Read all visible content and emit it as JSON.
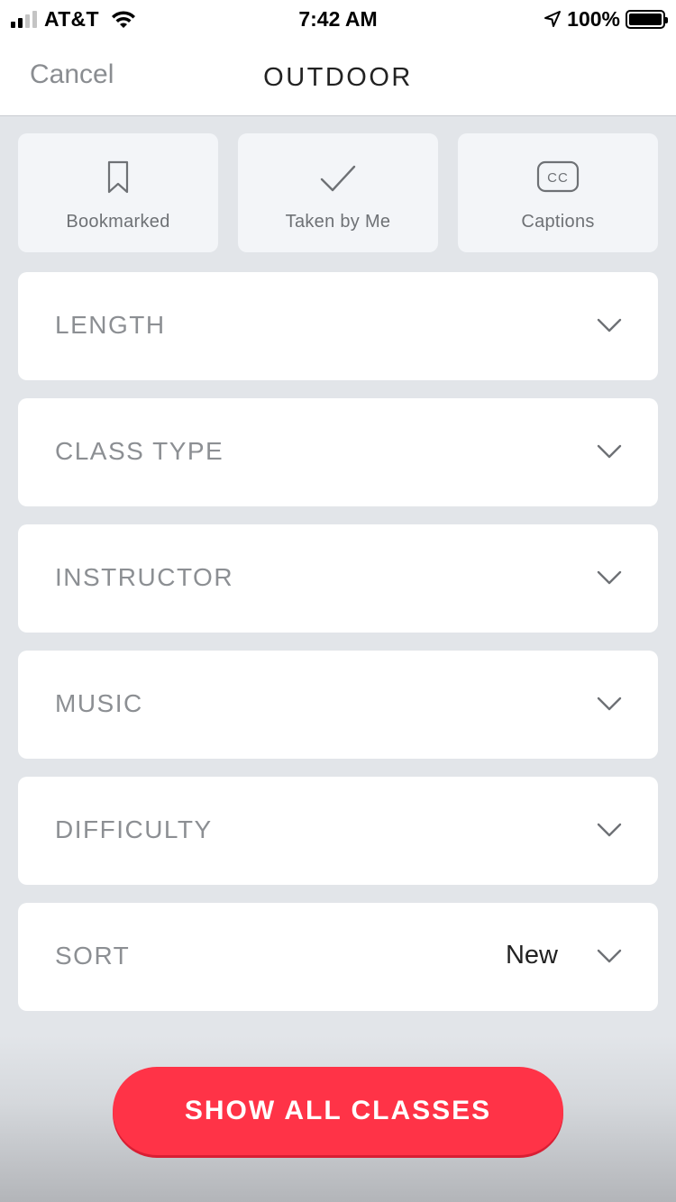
{
  "status_bar": {
    "carrier": "AT&T",
    "time": "7:42 AM",
    "battery_percent": "100%",
    "battery_level": 1.0,
    "signal_bars_filled": 2,
    "signal_bars_total": 4
  },
  "nav": {
    "cancel_label": "Cancel",
    "title": "OUTDOOR"
  },
  "chips": [
    {
      "label": "Bookmarked",
      "icon": "bookmark-icon"
    },
    {
      "label": "Taken by Me",
      "icon": "checkmark-icon"
    },
    {
      "label": "Captions",
      "icon": "cc-icon"
    }
  ],
  "filters": [
    {
      "label": "LENGTH",
      "value": ""
    },
    {
      "label": "CLASS TYPE",
      "value": ""
    },
    {
      "label": "INSTRUCTOR",
      "value": ""
    },
    {
      "label": "MUSIC",
      "value": ""
    },
    {
      "label": "DIFFICULTY",
      "value": ""
    },
    {
      "label": "SORT",
      "value": "New"
    }
  ],
  "cta": {
    "label": "SHOW ALL CLASSES"
  },
  "colors": {
    "accent": "#ff3347",
    "background": "#e2e5e9",
    "chip_bg": "#f3f5f8",
    "muted_text": "#8c8f93"
  }
}
